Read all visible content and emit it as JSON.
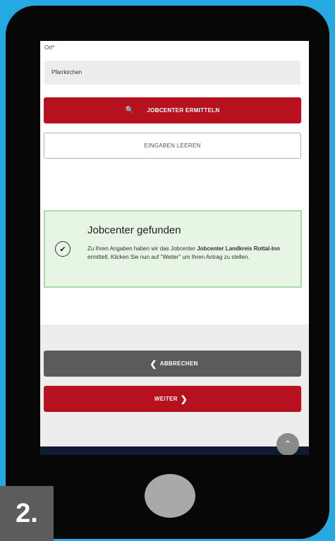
{
  "form": {
    "label": "Ort*",
    "value": "Pfarrkirchen",
    "search_button_icon": "magnifier-icon",
    "search_button_label": "JOBCENTER ERMITTELN",
    "clear_button_label": "EINGABEN LEEREN"
  },
  "alert": {
    "icon": "check-circle-icon",
    "title": "Jobcenter gefunden",
    "text_part1": "Zu Ihren Angaben haben wir das Jobcenter ",
    "text_bold": "Jobcenter Landkreis Rottal-Inn",
    "text_part2": " ermittelt. Klicken Sie nun auf \"Weiter\" um Ihren Antrag zu stellen."
  },
  "footer": {
    "cancel_label": "ABBRECHEN",
    "next_label": "WEITER"
  },
  "step_badge": "2.",
  "colors": {
    "background": "#25a9e0",
    "primary_red": "#b5111e",
    "success_bg": "#e6f5e4",
    "success_border": "#a6dba6"
  }
}
